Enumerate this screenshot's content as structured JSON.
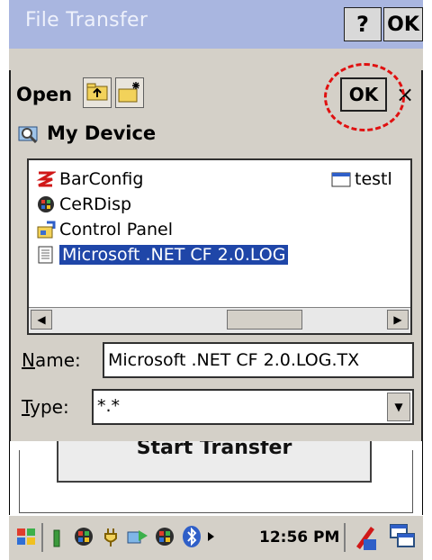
{
  "background_window": {
    "title": "File Transfer",
    "help_button": "?",
    "ok_button": "OK",
    "start_button": "Start Transfer"
  },
  "dialog": {
    "title": "Open",
    "ok_button": "OK",
    "close_button": "×",
    "location": "My Device",
    "files": [
      {
        "name": "BarConfig",
        "icon": "barconfig-icon"
      },
      {
        "name": "CeRDisp",
        "icon": "app-icon"
      },
      {
        "name": "Control Panel",
        "icon": "control-panel-icon"
      },
      {
        "name": "Microsoft .NET CF 2.0.LOG",
        "icon": "log-file-icon",
        "selected": true
      },
      {
        "name": "testl",
        "icon": "window-file-icon"
      }
    ],
    "name_label_underline": "N",
    "name_label_rest": "ame:",
    "name_value": "Microsoft .NET CF 2.0.LOG.TX",
    "type_label_underline": "T",
    "type_label_rest": "ype:",
    "type_value": "*.*"
  },
  "taskbar": {
    "clock": "12:56 PM"
  },
  "colors": {
    "titlebar": "#a9b6e0",
    "selection": "#1f46a8",
    "annotation": "#e01010",
    "chrome": "#d4d0c8"
  }
}
